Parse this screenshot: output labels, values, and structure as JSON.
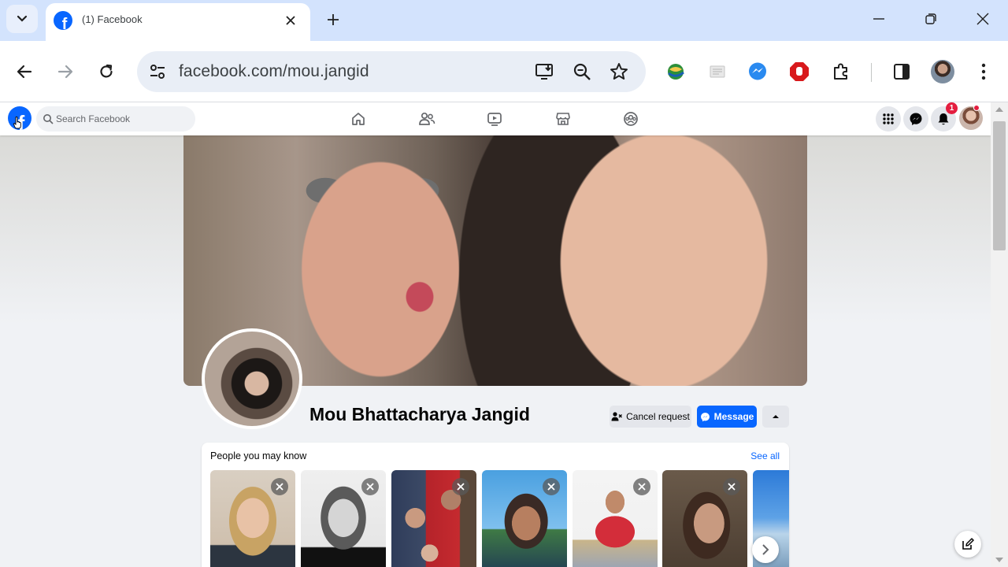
{
  "tab": {
    "title": "(1) Facebook",
    "favicon_letter": "f"
  },
  "address_bar": {
    "url": "facebook.com/mou.jangid"
  },
  "fb": {
    "logo_letter": "f",
    "search_placeholder": "Search Facebook",
    "notification_count": "1"
  },
  "profile": {
    "name": "Mou Bhattacharya Jangid",
    "cancel_request_label": "Cancel request",
    "message_label": "Message"
  },
  "people_you_may_know": {
    "title": "People you may know",
    "see_all_label": "See all"
  },
  "colors": {
    "fb_blue": "#0866ff",
    "tab_strip": "#d3e3fd",
    "badge_red": "#e41e3f"
  }
}
